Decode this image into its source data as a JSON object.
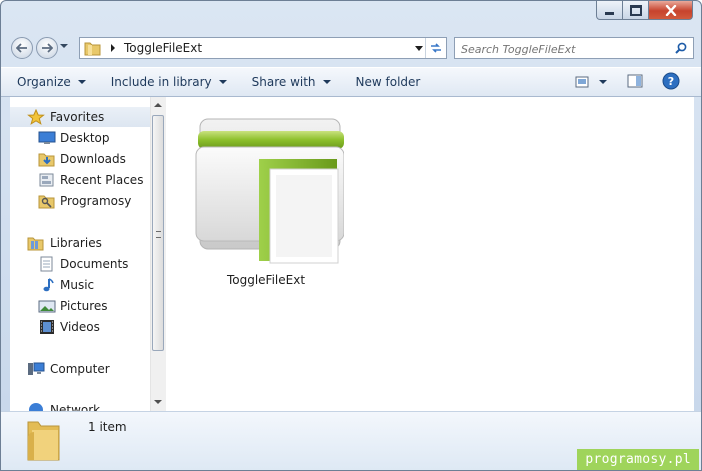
{
  "window": {
    "title_bar": {
      "minimize": "minimize",
      "maximize": "maximize",
      "close": "close"
    }
  },
  "address_bar": {
    "path": "ToggleFileExt",
    "search_placeholder": "Search ToggleFileExt"
  },
  "command_bar": {
    "items": [
      {
        "label": "Organize",
        "has_dropdown": true
      },
      {
        "label": "Include in library",
        "has_dropdown": true
      },
      {
        "label": "Share with",
        "has_dropdown": true
      },
      {
        "label": "New folder",
        "has_dropdown": false
      }
    ]
  },
  "nav_pane": {
    "favorites": {
      "label": "Favorites",
      "icon": "star-icon"
    },
    "favorites_items": [
      {
        "label": "Desktop",
        "icon": "desktop-icon"
      },
      {
        "label": "Downloads",
        "icon": "downloads-icon"
      },
      {
        "label": "Recent Places",
        "icon": "recent-places-icon"
      },
      {
        "label": "Programosy",
        "icon": "shortcut-folder-icon"
      }
    ],
    "libraries": {
      "label": "Libraries",
      "icon": "libraries-icon"
    },
    "libraries_items": [
      {
        "label": "Documents",
        "icon": "documents-icon"
      },
      {
        "label": "Music",
        "icon": "music-icon"
      },
      {
        "label": "Pictures",
        "icon": "pictures-icon"
      },
      {
        "label": "Videos",
        "icon": "videos-icon"
      }
    ],
    "computer": {
      "label": "Computer",
      "icon": "computer-icon"
    },
    "network": {
      "label": "Network",
      "icon": "network-icon"
    }
  },
  "content": {
    "items": [
      {
        "name": "ToggleFileExt",
        "icon": "green-folder-icon"
      }
    ]
  },
  "details_pane": {
    "item_count": "1 item"
  },
  "watermark": "programosy.pl",
  "colors": {
    "accent": "#1e395b",
    "folder_green": "#8cbf2b",
    "watermark_bg": "#9fd45b"
  }
}
